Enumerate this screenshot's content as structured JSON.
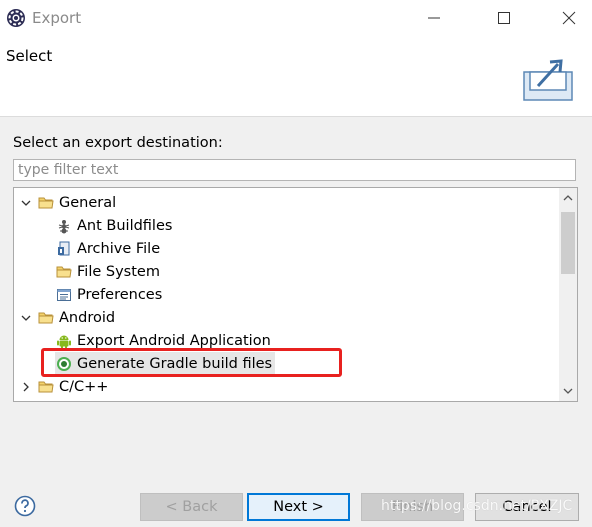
{
  "window": {
    "title": "Export"
  },
  "header": {
    "title": "Select"
  },
  "main": {
    "prompt": "Select an export destination:",
    "filter_placeholder": "type filter text",
    "tree": {
      "general_label": "General",
      "general_children": [
        "Ant Buildfiles",
        "Archive File",
        "File System",
        "Preferences"
      ],
      "android_label": "Android",
      "android_children": [
        "Export Android Application",
        "Generate Gradle build files"
      ],
      "cpp_label": "C/C++",
      "selected_item": "Generate Gradle build files"
    }
  },
  "footer": {
    "back_label": "< Back",
    "next_label": "Next >",
    "finish_label": "Finish",
    "cancel_label": "Cancel"
  },
  "watermark": "https://blog.csdn.net/PXZJC",
  "colors": {
    "highlight_border": "#e8211f",
    "primary_button_border": "#0078d7",
    "selection_bg": "#e6e6e6"
  },
  "icons": {
    "app": "eclipse-gear-icon",
    "header": "export-tray-icon",
    "folder": "folder-icon",
    "ant": "ant-icon",
    "archive": "archive-file-icon",
    "file_system": "folder-icon",
    "preferences": "preferences-icon",
    "android": "android-robot-icon",
    "gradle": "gradle-icon",
    "help": "help-icon"
  }
}
